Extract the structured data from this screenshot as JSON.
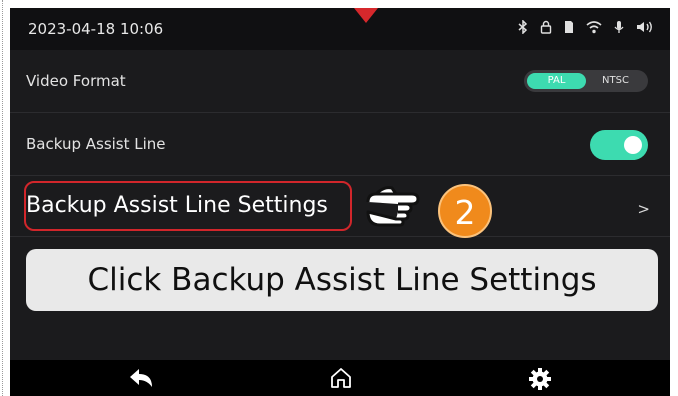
{
  "status_bar": {
    "datetime": "2023-04-18 10:06",
    "icons": [
      "bluetooth-icon",
      "lock-icon",
      "sd-card-icon",
      "wifi-icon",
      "microphone-icon",
      "speaker-icon"
    ]
  },
  "settings": {
    "video_format": {
      "label": "Video Format",
      "options": [
        "PAL",
        "NTSC"
      ],
      "selected": "PAL"
    },
    "backup_assist_line": {
      "label": "Backup Assist Line",
      "enabled": true
    },
    "backup_assist_line_settings": {
      "label": "Backup Assist Line Settings",
      "chevron": ">"
    }
  },
  "callout": {
    "step_number": "2",
    "instruction": "Click Backup Assist Line Settings"
  },
  "nav": {
    "icons": [
      "back-icon",
      "home-icon",
      "settings-gear-icon"
    ]
  },
  "colors": {
    "accent": "#3ddbb0",
    "highlight": "#d1262b",
    "badge": "#f08a1c",
    "background": "#1b1b1d"
  }
}
